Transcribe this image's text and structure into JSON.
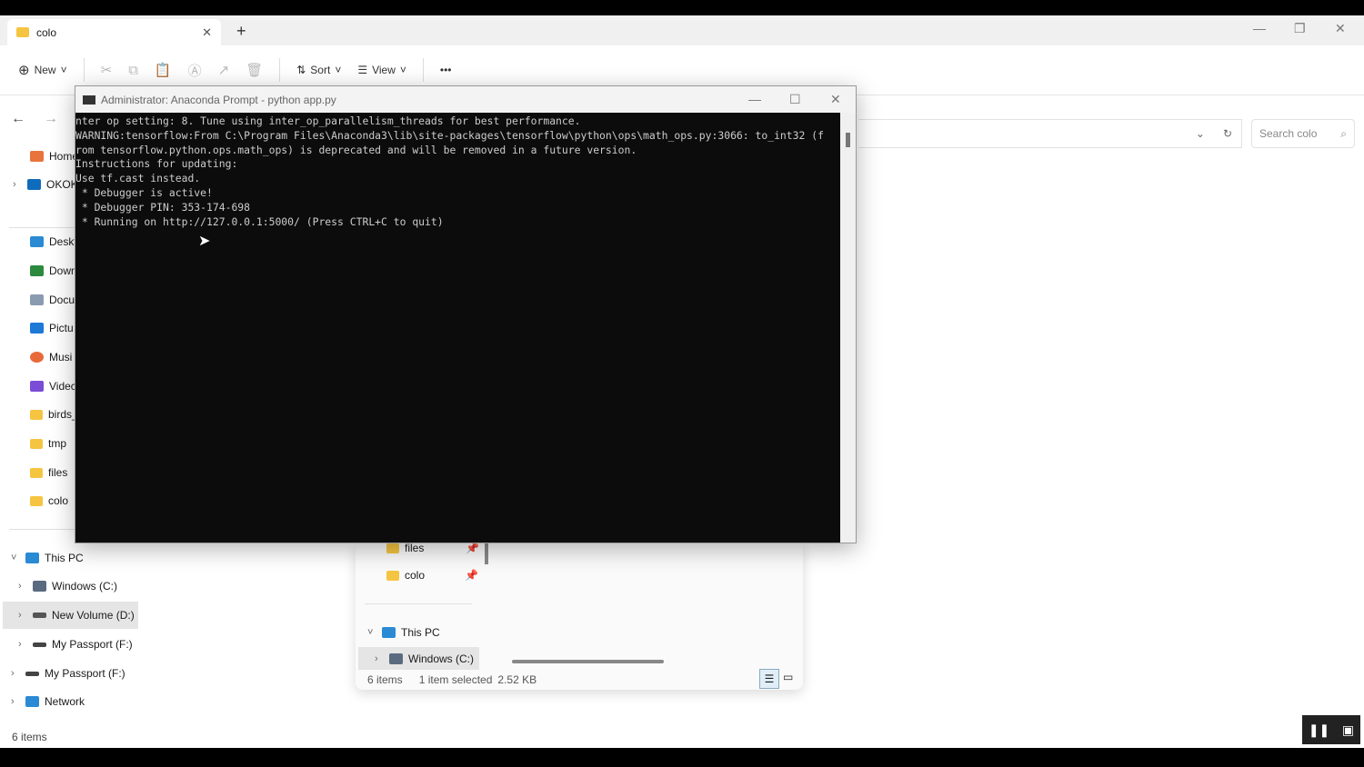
{
  "explorer": {
    "tab_title": "colo",
    "toolbar": {
      "new": "New",
      "sort": "Sort",
      "view": "View",
      "more": "•••"
    },
    "search_placeholder": "Search colo",
    "sidebar": [
      {
        "label": "Home",
        "color": "#e8743b"
      },
      {
        "label": "OKOK",
        "color": "#0f6cbd"
      },
      {
        "label": "Deskt",
        "color": "#2a8ad4"
      },
      {
        "label": "Down",
        "color": "#2b8a3e"
      },
      {
        "label": "Docu",
        "color": "#8a9bb0"
      },
      {
        "label": "Pictu",
        "color": "#1e78d6"
      },
      {
        "label": "Musi",
        "color": "#e86a3b"
      },
      {
        "label": "Videc",
        "color": "#7b4cd6"
      },
      {
        "label": "birds_",
        "color": "#f5c542"
      },
      {
        "label": "tmp",
        "color": "#f5c542"
      },
      {
        "label": "files",
        "color": "#f5c542"
      },
      {
        "label": "colo",
        "color": "#f5c542"
      }
    ],
    "tree": [
      {
        "label": "This PC"
      },
      {
        "label": "Windows (C:)"
      },
      {
        "label": "New Volume (D:)"
      },
      {
        "label": "My Passport (F:)"
      },
      {
        "label": "My Passport (F:)"
      },
      {
        "label": "Network"
      }
    ],
    "status": "6 items"
  },
  "subwindow": {
    "items": [
      "files",
      "colo"
    ],
    "this_pc": "This PC",
    "windows_c": "Windows (C:)",
    "status_count": "6 items",
    "status_selected": "1 item selected",
    "status_size": "2.52 KB"
  },
  "terminal": {
    "title": "Administrator: Anaconda Prompt - python  app.py",
    "output": "nter op setting: 8. Tune using inter_op_parallelism_threads for best performance.\nWARNING:tensorflow:From C:\\Program Files\\Anaconda3\\lib\\site-packages\\tensorflow\\python\\ops\\math_ops.py:3066: to_int32 (f\nrom tensorflow.python.ops.math_ops) is deprecated and will be removed in a future version.\nInstructions for updating:\nUse tf.cast instead.\n * Debugger is active!\n * Debugger PIN: 353-174-698\n * Running on http://127.0.0.1:5000/ (Press CTRL+C to quit)"
  }
}
